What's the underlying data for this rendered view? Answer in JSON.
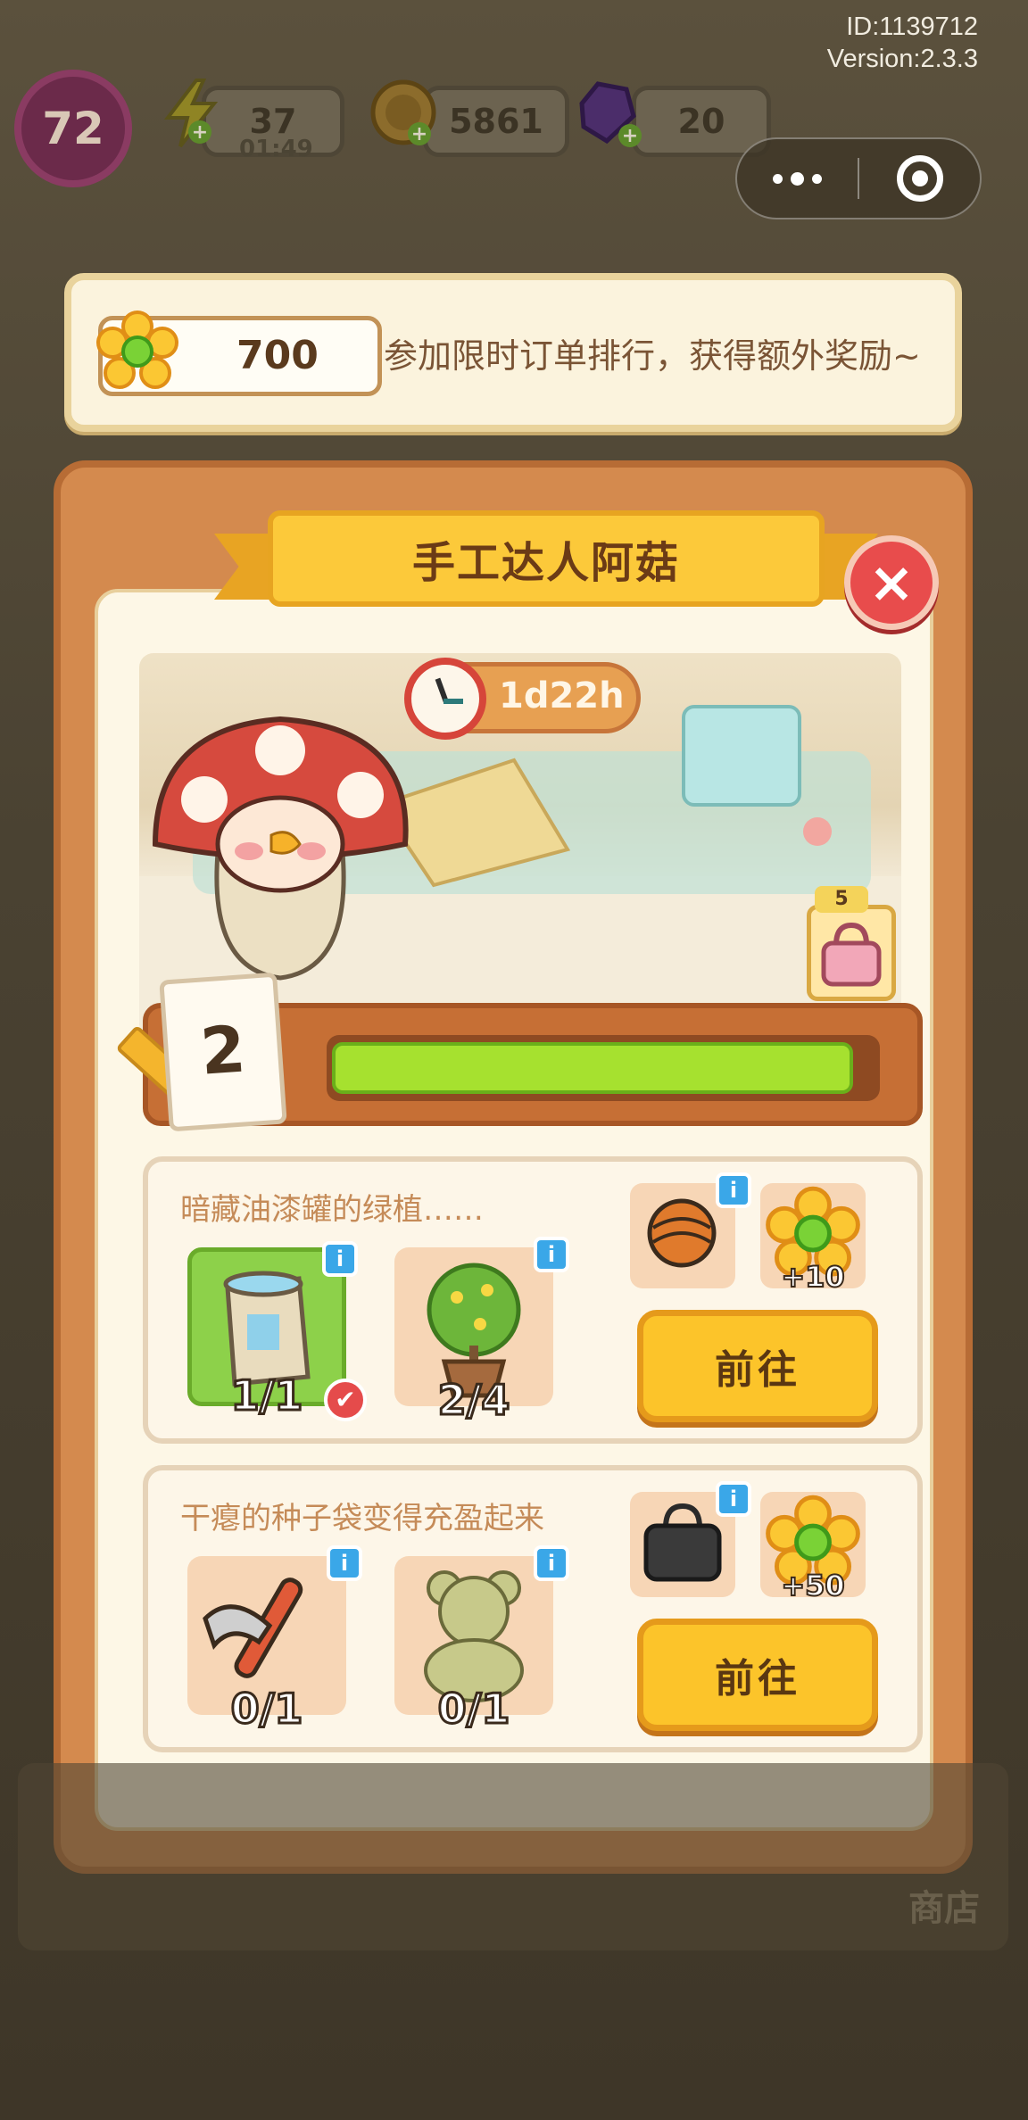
{
  "hud": {
    "id_text": "ID:1139712",
    "version_text": "Version:2.3.3",
    "level": "72",
    "energy": "37",
    "energy_timer": "01:49",
    "coins": "5861",
    "gems": "20",
    "colors": {
      "energy": "#f2d21c",
      "coin": "#f0b52a",
      "gem": "#6b3fa6"
    }
  },
  "banner": {
    "flower_value": "700",
    "message": "参加限时订单排行，获得额外奖励~"
  },
  "panel": {
    "title": "手工达人阿菇",
    "close_icon": "×",
    "timer": "1d22h",
    "stage": "2",
    "progress": 0.96,
    "chest_badge_count": "5",
    "colors": {
      "panel": "#d48a4e",
      "ribbon": "#fcc93a",
      "progress_fill": "#a6e12f"
    }
  },
  "tasks": [
    {
      "title": "暗藏油漆罐的绿植……",
      "items": [
        {
          "icon": "paint-bucket-icon",
          "count": "1/1",
          "completed": true
        },
        {
          "icon": "potted-plant-icon",
          "count": "2/4",
          "completed": false
        }
      ],
      "rewards": [
        {
          "icon": "yarn-ball-icon",
          "amount": ""
        },
        {
          "icon": "flower-icon",
          "amount": "+10"
        }
      ],
      "button": "前往"
    },
    {
      "title": "干瘪的种子袋变得充盈起来",
      "items": [
        {
          "icon": "pickaxe-icon",
          "count": "0/1",
          "completed": false
        },
        {
          "icon": "teddy-bear-icon",
          "count": "0/1",
          "completed": false
        }
      ],
      "rewards": [
        {
          "icon": "black-bag-icon",
          "amount": ""
        },
        {
          "icon": "flower-icon",
          "amount": "+50"
        }
      ],
      "button": "前往"
    }
  ],
  "bottom": {
    "shop_label": "商店"
  },
  "info_glyph": "i",
  "check_glyph": "✔"
}
